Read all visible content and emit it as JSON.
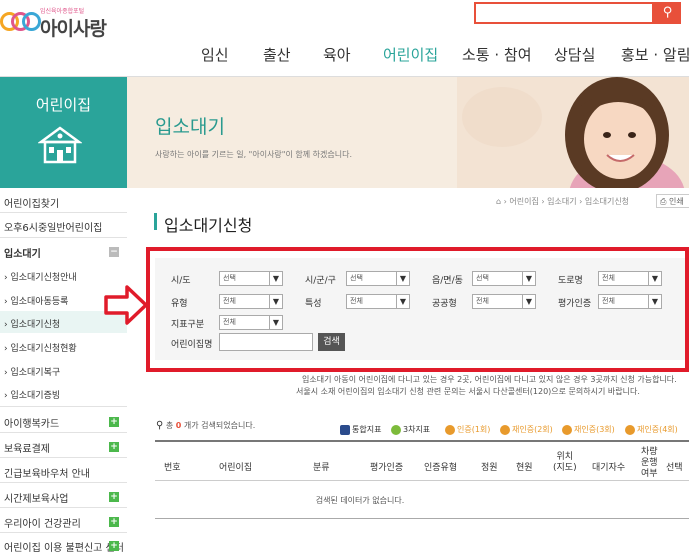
{
  "header": {
    "logo_sub": "임신육아종합포털",
    "logo_main": "아이사랑",
    "search_placeholder": "",
    "nav": [
      "임신",
      "출산",
      "육아",
      "어린이집",
      "소통 · 참여",
      "상담실",
      "홍보 · 알림"
    ],
    "active_nav": "어린이집",
    "accent": "#e8503a",
    "nav_active_color": "#2aa49a"
  },
  "sidebar": {
    "title": "어린이집",
    "items": [
      {
        "label": "어린이집찾기"
      },
      {
        "label": "오후6시중일반어린이집"
      },
      {
        "label": "입소대기"
      },
      {
        "label": "› 입소대기신청안내"
      },
      {
        "label": "› 입소대아동등록"
      },
      {
        "label": "› 입소대기신청"
      },
      {
        "label": "› 입소대기신청현황"
      },
      {
        "label": "› 입소대기복구"
      },
      {
        "label": "› 입소대기증빙"
      },
      {
        "label": "아이행복카드"
      },
      {
        "label": "보육료결제"
      },
      {
        "label": "긴급보육바우처 안내"
      },
      {
        "label": "시간제보육사업"
      },
      {
        "label": "우리아이 건강관리"
      },
      {
        "label": "어린이집 이용 불편신고 센터"
      }
    ]
  },
  "banner": {
    "title": "입소대기",
    "subtitle": "사랑하는 아이를 기르는 일, \"아이사랑\"이 함께 하겠습니다."
  },
  "breadcrumb": {
    "home": "⌂",
    "items": [
      "어린이집",
      "입소대기",
      "입소대기신청"
    ],
    "print": "인쇄"
  },
  "page_title": "입소대기신청",
  "filters": {
    "sido_label": "시/도",
    "sido_value": "선택",
    "sigungu_label": "시/군/구",
    "sigungu_value": "선택",
    "eupmyeon_label": "읍/면/동",
    "eupmyeon_value": "선택",
    "road_label": "도로명",
    "road_value": "전체",
    "type_label": "유형",
    "type_value": "전체",
    "special_label": "특성",
    "special_value": "전체",
    "public_label": "공공형",
    "public_value": "전체",
    "eval_label": "평가인증",
    "eval_value": "전체",
    "indicator_label": "지표구분",
    "indicator_value": "전체",
    "name_label": "어린이집명",
    "name_value": "",
    "search_button": "검색"
  },
  "notice": {
    "line1": "입소대기 아동이 어린이집에 다니고 있는 경우 2곳, 어린이집에 다니고 있지 않은 경우 3곳까지 신청 가능합니다.",
    "line2": "서울시 소재 어린이집의 입소대기 신청 관련 문의는 서울시 다산콜센터(120)으로 문의하시기 바랍니다."
  },
  "results": {
    "prefix": "총",
    "count": "0",
    "suffix": "개가 검색되었습니다.",
    "legend": [
      {
        "label": "통합지표",
        "color": "#2b4b8c"
      },
      {
        "label": "3차지표",
        "color": "#7dbb3b"
      },
      {
        "label": "인증(1회)",
        "color": "#e89a2c"
      },
      {
        "label": "재인증(2회)",
        "color": "#e89a2c"
      },
      {
        "label": "재인증(3회)",
        "color": "#e89a2c"
      },
      {
        "label": "재인증(4회)",
        "color": "#e89a2c"
      }
    ]
  },
  "table": {
    "headers": [
      "번호",
      "어린이집",
      "분류",
      "평가인증",
      "인증유형",
      "정원",
      "현원",
      "위치\n(지도)",
      "대기자수",
      "차량\n운행\n여부",
      "선택"
    ],
    "empty_message": "검색된 데이터가 없습니다."
  }
}
